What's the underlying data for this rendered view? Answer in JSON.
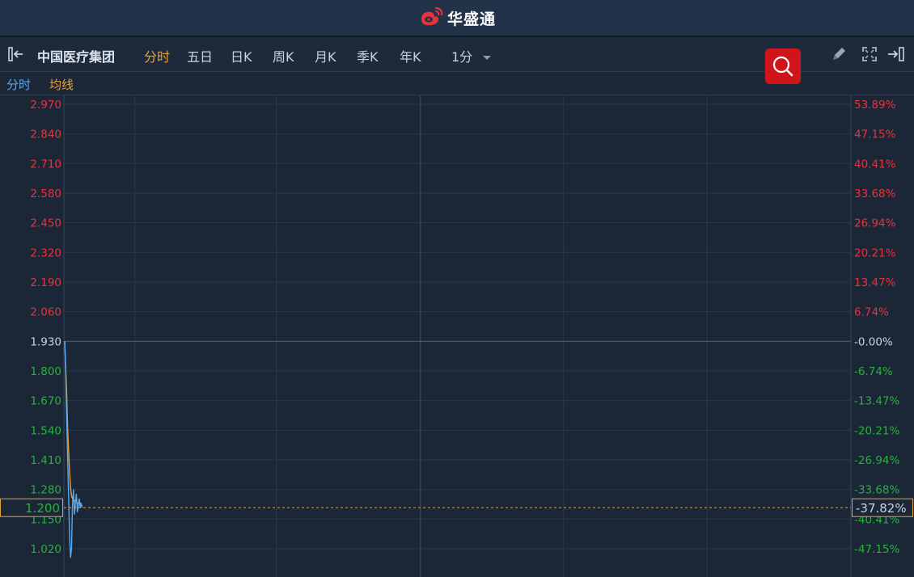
{
  "header": {
    "brand": "华盛通"
  },
  "toolbar": {
    "stock_name": "中国医疗集团",
    "tabs": [
      "分时",
      "五日",
      "日K",
      "周K",
      "月K",
      "季K",
      "年K"
    ],
    "active_tab": "分时",
    "interval": "1分"
  },
  "legend": {
    "series1": "分时",
    "series2": "均线"
  },
  "colors": {
    "up": "#e8333a",
    "down": "#26b33c",
    "flat": "#c9d3e0",
    "price_line": "#5aa8f0",
    "avg_line": "#e8a13a",
    "accent": "#e8a13a",
    "search_button": "#d0141c"
  },
  "icons": [
    "collapse-left-icon",
    "chevron-down-icon",
    "search-icon",
    "pencil-icon",
    "fullscreen-icon",
    "collapse-right-icon",
    "brand-logo-icon"
  ],
  "chart_data": {
    "type": "line",
    "title": "",
    "prev_close": 1.93,
    "y_ticks": [
      "2.970",
      "2.840",
      "2.710",
      "2.580",
      "2.450",
      "2.320",
      "2.190",
      "2.060",
      "1.930",
      "1.800",
      "1.670",
      "1.540",
      "1.410",
      "1.280",
      "1.150",
      "1.020"
    ],
    "y_ticks_pct": [
      "53.89%",
      "47.15%",
      "40.41%",
      "33.68%",
      "26.94%",
      "20.21%",
      "13.47%",
      "6.74%",
      "-0.00%",
      "-6.74%",
      "-13.47%",
      "-20.21%",
      "-26.94%",
      "-33.68%",
      "-40.41%",
      "-47.15%"
    ],
    "ylim": [
      0.9,
      3.0
    ],
    "current_price": "1.200",
    "current_change": "-37.82%",
    "grid": true,
    "series": [
      {
        "name": "分时",
        "values": [
          1.93,
          1.8,
          1.61,
          1.42,
          1.25,
          1.08,
          0.98,
          1.02,
          1.21,
          1.28,
          1.17,
          1.22,
          1.26,
          1.18,
          1.21,
          1.24,
          1.2,
          1.22,
          1.2
        ]
      },
      {
        "name": "均线",
        "values": [
          1.93,
          1.82,
          1.7,
          1.55,
          1.45,
          1.36,
          1.29,
          1.25,
          1.24,
          1.24,
          1.23,
          1.23,
          1.23,
          1.22,
          1.22,
          1.22,
          1.22,
          1.21,
          1.21
        ]
      }
    ]
  }
}
